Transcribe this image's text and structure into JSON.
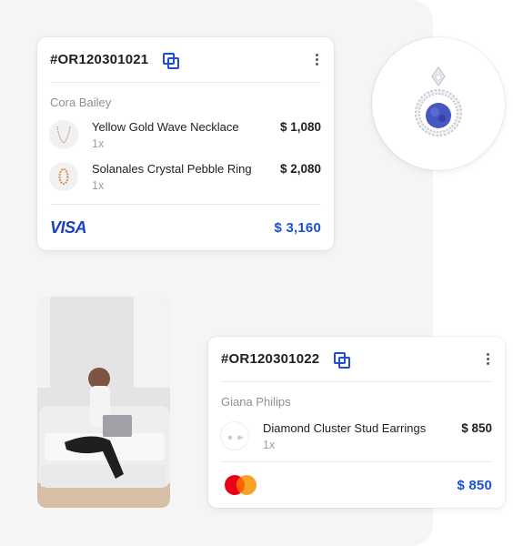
{
  "orders": [
    {
      "id": "#OR120301021",
      "customer": "Cora Bailey",
      "items": [
        {
          "name": "Yellow Gold Wave Necklace",
          "qty": "1x",
          "price": "$ 1,080",
          "thumb": "necklace"
        },
        {
          "name": "Solanales Crystal Pebble Ring",
          "qty": "1x",
          "price": "$ 2,080",
          "thumb": "ring"
        }
      ],
      "payment": {
        "method": "VISA",
        "icon": "visa-logo"
      },
      "total": "$ 3,160"
    },
    {
      "id": "#OR120301022",
      "customer": "Giana Philips",
      "items": [
        {
          "name": "Diamond Cluster Stud Earrings",
          "qty": "1x",
          "price": "$ 850",
          "thumb": "earrings"
        }
      ],
      "payment": {
        "method": "Mastercard",
        "icon": "mastercard-logo"
      },
      "total": "$ 850"
    }
  ],
  "images": {
    "pendant": "sapphire-pendant",
    "lifestyle": "woman-on-sofa-with-laptop"
  },
  "colors": {
    "accent": "#1b4fd6",
    "text": "#1d1f24",
    "muted": "#8b8f97",
    "panel": "#f5f5f6"
  }
}
